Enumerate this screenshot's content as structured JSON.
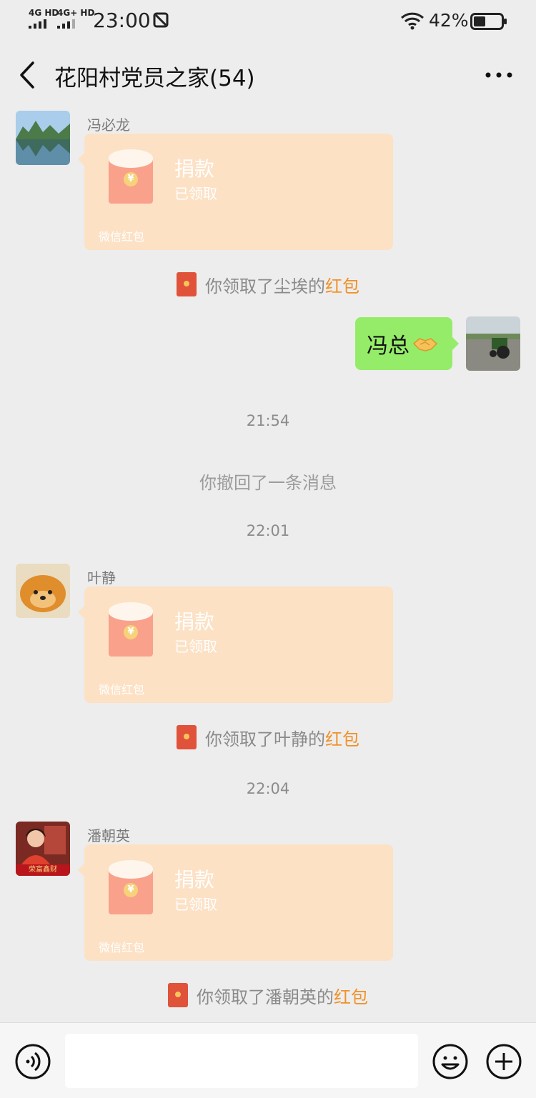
{
  "status_bar": {
    "network_1": "4G HD",
    "network_2": "4G+ HD",
    "time": "23:00",
    "battery_percent": "42%",
    "battery_level": 0.42,
    "icons": [
      "signal-icon",
      "dnd-icon",
      "wifi-icon",
      "battery-icon"
    ]
  },
  "nav": {
    "title": "花阳村党员之家(54)",
    "icons": [
      "back-icon",
      "more-icon"
    ]
  },
  "messages": {
    "m1": {
      "sender": "冯必龙",
      "packet_title": "捐款",
      "packet_status": "已领取",
      "packet_source": "微信红包"
    },
    "sys1": {
      "text": "你领取了尘埃的",
      "link": "红包"
    },
    "mine": {
      "text": "冯总",
      "icon": "handshake-emoji"
    },
    "time1": "21:54",
    "recall": "你撤回了一条消息",
    "time2": "22:01",
    "m2": {
      "sender": "叶静",
      "packet_title": "捐款",
      "packet_status": "已领取",
      "packet_source": "微信红包"
    },
    "sys2": {
      "text": "你领取了叶静的",
      "link": "红包"
    },
    "time3": "22:04",
    "m3": {
      "sender": "潘朝英",
      "avatar_caption": "荣富鑫财",
      "packet_title": "捐款",
      "packet_status": "已领取",
      "packet_source": "微信红包"
    },
    "sys3": {
      "text": "你领取了潘朝英的",
      "link": "红包"
    }
  },
  "input_bar": {
    "message_value": "",
    "icons": [
      "voice-icon",
      "emoji-icon",
      "plus-icon"
    ]
  },
  "colors": {
    "background": "#ededed",
    "red_packet": "#fce1c5",
    "my_bubble": "#95ec69",
    "link_orange": "#f09128"
  }
}
